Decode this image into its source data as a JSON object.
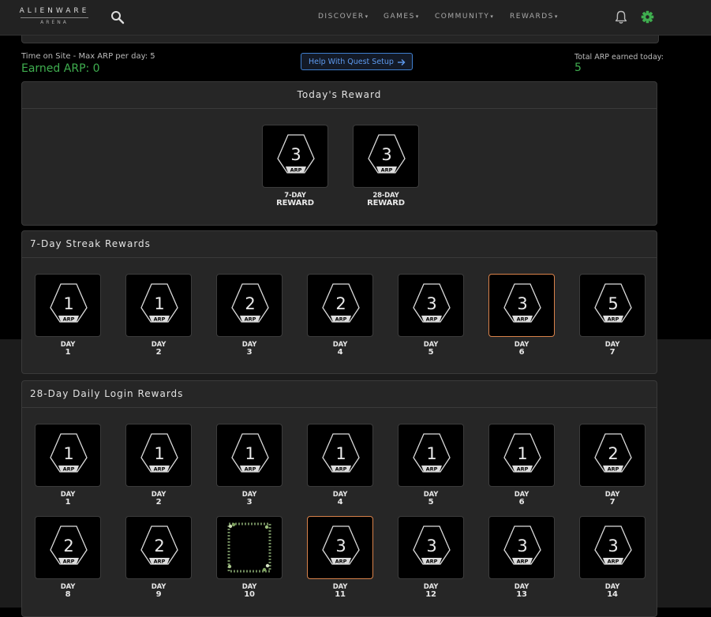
{
  "header": {
    "brand": "ALIENWARE",
    "brand_sub": "ARENA",
    "nav": [
      "DISCOVER",
      "GAMES",
      "COMMUNITY",
      "REWARDS"
    ]
  },
  "stats": {
    "time_on_site": "Time on Site - Max ARP per day: 5",
    "earned": "Earned ARP: 0",
    "help_button": "Help With Quest Setup",
    "total_label": "Total ARP earned today:",
    "total_value": "5"
  },
  "badge_label": "ARP",
  "todays_reward": {
    "title": "Today's Reward",
    "items": [
      {
        "value": "3",
        "line1": "7-DAY",
        "line2": "REWARD"
      },
      {
        "value": "3",
        "line1": "28-DAY",
        "line2": "REWARD"
      }
    ]
  },
  "streak": {
    "title": "7-Day Streak Rewards",
    "days": [
      {
        "label": "DAY",
        "day": "1",
        "value": "1"
      },
      {
        "label": "DAY",
        "day": "2",
        "value": "1"
      },
      {
        "label": "DAY",
        "day": "3",
        "value": "2"
      },
      {
        "label": "DAY",
        "day": "4",
        "value": "2"
      },
      {
        "label": "DAY",
        "day": "5",
        "value": "3"
      },
      {
        "label": "DAY",
        "day": "6",
        "value": "3",
        "current": true
      },
      {
        "label": "DAY",
        "day": "7",
        "value": "5"
      }
    ]
  },
  "daily": {
    "title": "28-Day Daily Login Rewards",
    "days": [
      {
        "label": "DAY",
        "day": "1",
        "value": "1"
      },
      {
        "label": "DAY",
        "day": "2",
        "value": "1"
      },
      {
        "label": "DAY",
        "day": "3",
        "value": "1"
      },
      {
        "label": "DAY",
        "day": "4",
        "value": "1"
      },
      {
        "label": "DAY",
        "day": "5",
        "value": "1"
      },
      {
        "label": "DAY",
        "day": "6",
        "value": "1"
      },
      {
        "label": "DAY",
        "day": "7",
        "value": "2"
      },
      {
        "label": "DAY",
        "day": "8",
        "value": "2"
      },
      {
        "label": "DAY",
        "day": "9",
        "value": "2"
      },
      {
        "label": "DAY",
        "day": "10",
        "value": "",
        "special": true
      },
      {
        "label": "DAY",
        "day": "11",
        "value": "3",
        "current": true
      },
      {
        "label": "DAY",
        "day": "12",
        "value": "3"
      },
      {
        "label": "DAY",
        "day": "13",
        "value": "3"
      },
      {
        "label": "DAY",
        "day": "14",
        "value": "3"
      }
    ]
  },
  "colors": {
    "accent_green": "#3fae4f",
    "link_blue": "#3f7fcf",
    "highlight_orange": "#d9824a"
  }
}
